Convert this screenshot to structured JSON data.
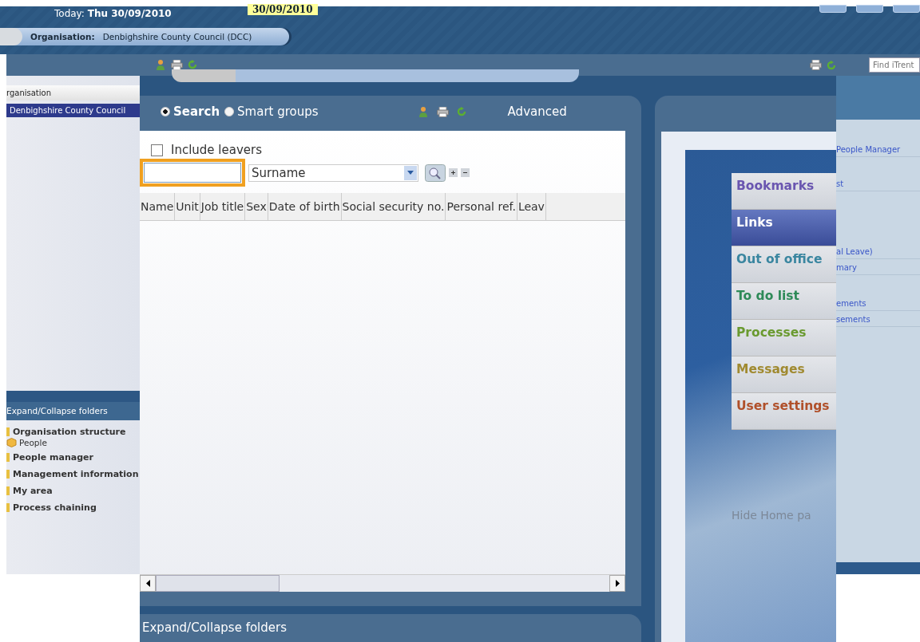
{
  "header": {
    "today_label": "Today:",
    "today_value": "Thu 30/09/2010",
    "date_badge": "30/09/2010"
  },
  "breadcrumb": {
    "label": "Organisation:",
    "value": "Denbighshire County Council (DCC)"
  },
  "find_field": {
    "placeholder": "Find iTrent"
  },
  "org_panel": {
    "title": "rganisation",
    "items": [
      {
        "label": "Denbighshire County Council",
        "selected": true
      }
    ]
  },
  "folders": {
    "title": "Expand/Collapse folders",
    "tree": [
      {
        "label": "Organisation structure",
        "children": [
          {
            "label": "People",
            "kind": "box"
          }
        ]
      },
      {
        "label": "People manager"
      },
      {
        "label": "Management information"
      },
      {
        "label": "My area"
      },
      {
        "label": "Process chaining"
      }
    ]
  },
  "back_links": [
    "People Manager",
    "st",
    "al Leave)",
    "mary",
    "ements",
    "sements"
  ],
  "search_panel": {
    "modes": [
      {
        "label": "Search",
        "selected": true
      },
      {
        "label": "Smart groups",
        "selected": false
      }
    ],
    "advanced": "Advanced",
    "include_leavers": {
      "label": "Include leavers",
      "checked": false
    },
    "field_select": "Surname",
    "columns": [
      "Name",
      "Unit",
      "Job title",
      "Sex",
      "Date of birth",
      "Social security no.",
      "Personal ref.",
      "Leav"
    ],
    "footer": "Expand/Collapse folders"
  },
  "home_menu": {
    "items": [
      {
        "label": "Bookmarks",
        "selected": false,
        "color": "#6a56b0"
      },
      {
        "label": "Links",
        "selected": true
      },
      {
        "label": "Out of office",
        "selected": false,
        "color": "#3a86a0"
      },
      {
        "label": "To do list",
        "selected": false,
        "color": "#2e8a58"
      },
      {
        "label": "Processes",
        "selected": false,
        "color": "#6a9a30"
      },
      {
        "label": "Messages",
        "selected": false,
        "color": "#a08a30"
      },
      {
        "label": "User settings",
        "selected": false,
        "color": "#b0502a"
      }
    ],
    "hide_link": "Hide Home pa"
  }
}
